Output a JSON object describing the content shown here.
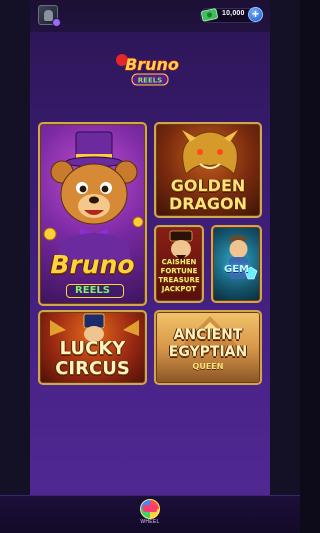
{
  "header": {
    "coins_value": "10,000",
    "plus_symbol": "+"
  },
  "logo": {
    "name": "Bruno",
    "sub": "REELS"
  },
  "games": [
    {
      "title": "Bruno",
      "subtitle": "REELS"
    },
    {
      "title_line1": "GOLDEN",
      "title_line2": "DRAGON"
    },
    {
      "line1": "CAISHEN",
      "line2": "FORTUNE",
      "line3": "TREASURE",
      "line4": "JACKPOT"
    },
    {
      "title": "GEM"
    },
    {
      "line1": "LUCKY",
      "line2": "CIRCUS"
    },
    {
      "line1": "ANCIENT",
      "line2": "EGYPTIAN",
      "line3": "QUEEN"
    }
  ],
  "bottom_nav": {
    "wheel_label": "WHEEL"
  },
  "colors": {
    "panel_top": "#2b1554",
    "panel_bottom": "#512892",
    "tile_border": "#d4a64a",
    "gold_text": "#ffe27a"
  }
}
